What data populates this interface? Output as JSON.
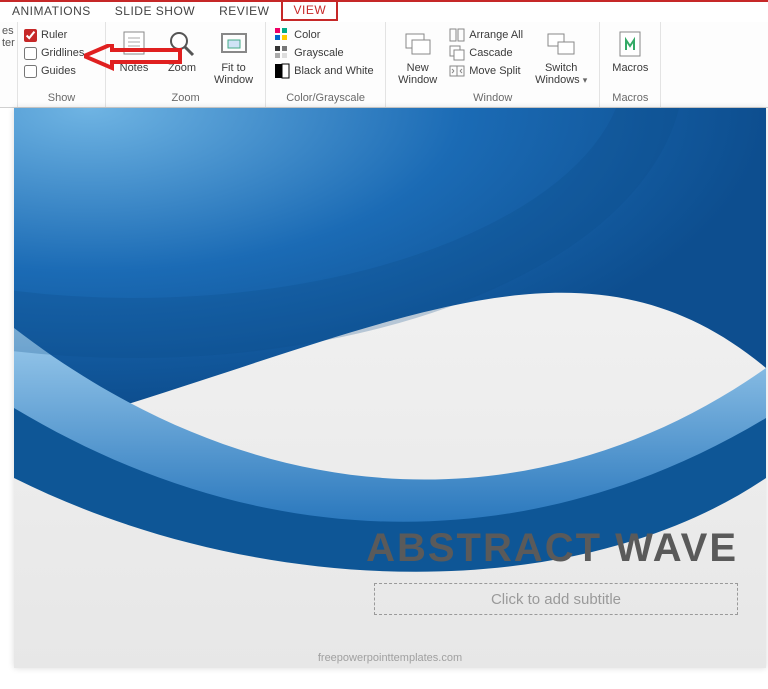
{
  "tabs": {
    "animations": "ANIMATIONS",
    "slide_show": "SLIDE SHOW",
    "review": "REVIEW",
    "view": "VIEW"
  },
  "ribbon": {
    "master_partial": {
      "line1": "es",
      "line2": "ter"
    },
    "show": {
      "ruler_label": "Ruler",
      "ruler_checked": true,
      "gridlines_label": "Gridlines",
      "gridlines_checked": false,
      "guides_label": "Guides",
      "guides_checked": false,
      "group_label": "Show"
    },
    "zoom": {
      "notes_label": "Notes",
      "zoom_label": "Zoom",
      "fit_label_1": "Fit to",
      "fit_label_2": "Window",
      "group_label": "Zoom"
    },
    "color": {
      "color_label": "Color",
      "grayscale_label": "Grayscale",
      "bw_label": "Black and White",
      "group_label": "Color/Grayscale"
    },
    "window": {
      "new_window_1": "New",
      "new_window_2": "Window",
      "arrange_label": "Arrange All",
      "cascade_label": "Cascade",
      "move_split_label": "Move Split",
      "switch_1": "Switch",
      "switch_2": "Windows",
      "group_label": "Window"
    },
    "macros": {
      "label": "Macros",
      "group_label": "Macros"
    }
  },
  "slide": {
    "title": "ABSTRACT WAVE",
    "subtitle_placeholder": "Click to add subtitle",
    "credit": "freepowerpointtemplates.com"
  },
  "colors": {
    "accent": "#c62828",
    "wave_dark": "#0d5ea6",
    "wave_mid": "#2d84c7",
    "wave_light": "#7fbce5"
  }
}
